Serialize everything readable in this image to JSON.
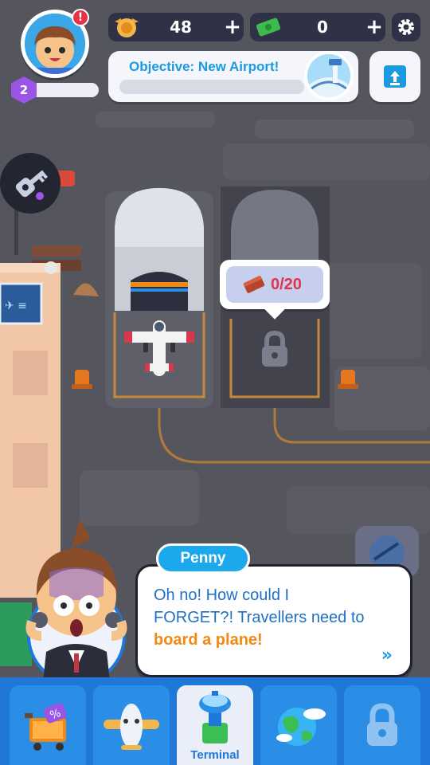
{
  "hud": {
    "player_level": "2",
    "level_progress": 0.06,
    "notification_mark": "!",
    "coins": "48",
    "cash": "0",
    "plus_symbol": "+"
  },
  "objective": {
    "label": "Objective: New Airport!",
    "progress": 0.0
  },
  "hangar_locked": {
    "bricks_progress": "0/20"
  },
  "dialog": {
    "speaker": "Penny",
    "line1": "Oh no! How could I",
    "line2": "FORGET?! Travellers need to",
    "line3_highlight": "board a plane!",
    "next_glyph": "»"
  },
  "tabs": [
    {
      "name": "shop",
      "label": "",
      "icon": "shopping-cart-icon"
    },
    {
      "name": "planes",
      "label": "",
      "icon": "airplane-icon"
    },
    {
      "name": "terminal",
      "label": "Terminal",
      "icon": "terminal-tower-icon",
      "active": true
    },
    {
      "name": "world",
      "label": "",
      "icon": "globe-icon"
    },
    {
      "name": "locked",
      "label": "",
      "icon": "lock-icon"
    }
  ],
  "colors": {
    "ground": "#55555e",
    "tabbar": "#1f78d8",
    "accent_blue": "#1b9ae0",
    "highlight_orange": "#f08a12",
    "brick_red": "#e0344b",
    "level_purple": "#9a55e6"
  }
}
